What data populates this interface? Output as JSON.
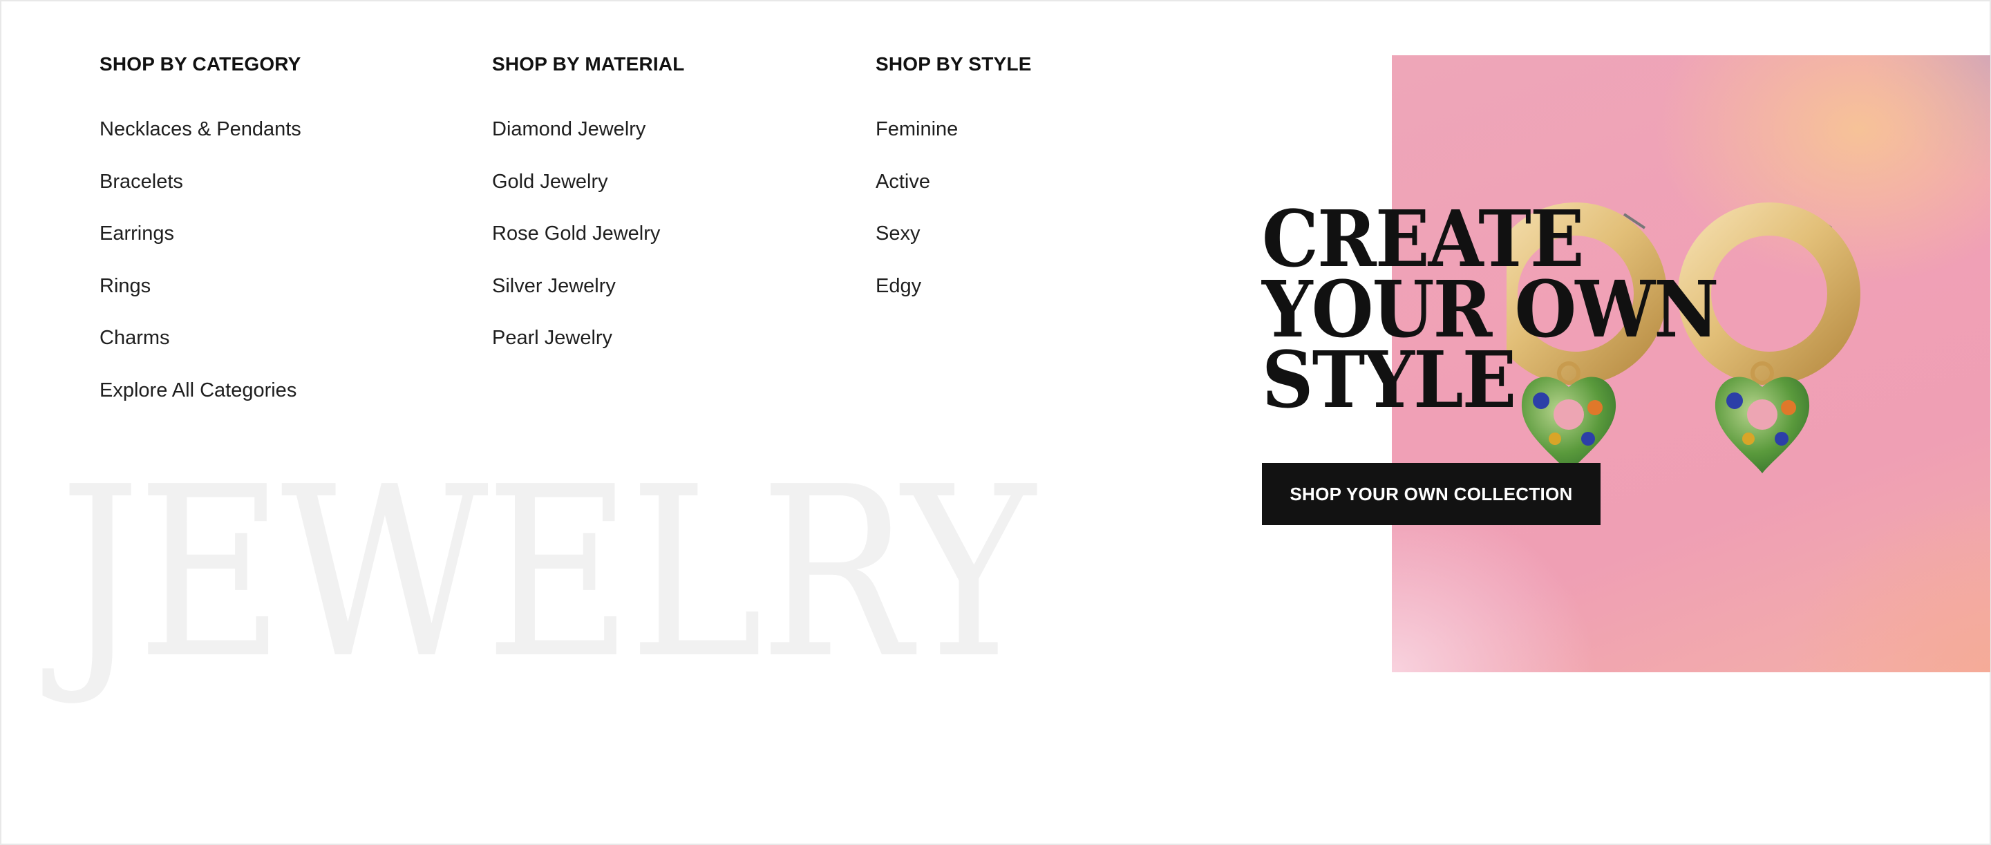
{
  "menu": {
    "category": {
      "heading": "SHOP BY CATEGORY",
      "items": [
        "Necklaces & Pendants",
        "Bracelets",
        "Earrings",
        "Rings",
        "Charms",
        "Explore All Categories"
      ]
    },
    "material": {
      "heading": "SHOP BY MATERIAL",
      "items": [
        "Diamond Jewelry",
        "Gold Jewelry",
        "Rose Gold Jewelry",
        "Silver Jewelry",
        "Pearl Jewelry"
      ]
    },
    "style": {
      "heading": "SHOP BY STYLE",
      "items": [
        "Feminine",
        "Active",
        "Sexy",
        "Edgy"
      ]
    }
  },
  "watermark": "JEWELRY",
  "promo": {
    "headline_lines": [
      "CREATE",
      "YOUR OWN",
      "STYLE"
    ],
    "cta_label": "SHOP YOUR OWN COLLECTION",
    "image_subject": "gold-hoop-earrings-with-heart-charms"
  },
  "colors": {
    "text": "#1f1f1f",
    "heading": "#111111",
    "watermark": "#f1f1f1",
    "cta_bg": "#121212",
    "cta_text": "#ffffff",
    "promo_pink": "#f0a0b6",
    "promo_peach": "#f7c496",
    "gold": "#e2bf78"
  }
}
